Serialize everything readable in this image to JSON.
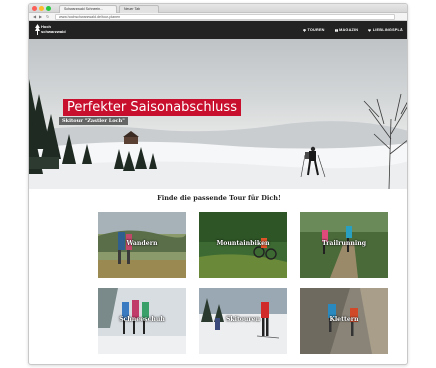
{
  "browser": {
    "tabs": [
      {
        "label": "Schwarzwald Schneein..."
      },
      {
        "label": "Neuer Tab"
      }
    ],
    "url": "www.hochschwarzwald.de/tour-planen"
  },
  "site": {
    "logo_text_line1": "Hoch",
    "logo_text_line2": "schwarzwald",
    "nav": [
      {
        "label": "TOUREN",
        "icon": "signpost-icon"
      },
      {
        "label": "MAGAZIN",
        "icon": "book-icon"
      },
      {
        "label": "LIEBLINGSPLÄ",
        "icon": "heart-icon"
      }
    ]
  },
  "hero": {
    "title": "Perfekter Saisonabschluss",
    "subtitle": "Skitour \"Zastler Loch\""
  },
  "section": {
    "title": "Finde die passende Tour für Dich!"
  },
  "tiles": [
    {
      "label": "Wandern"
    },
    {
      "label": "Mountainbiken"
    },
    {
      "label": "Trailrunning"
    },
    {
      "label": "Schneeschuh"
    },
    {
      "label": "Skitouren"
    },
    {
      "label": "Klettern"
    }
  ],
  "colors": {
    "accent_red": "#c8102e",
    "header_bg": "#222222"
  }
}
